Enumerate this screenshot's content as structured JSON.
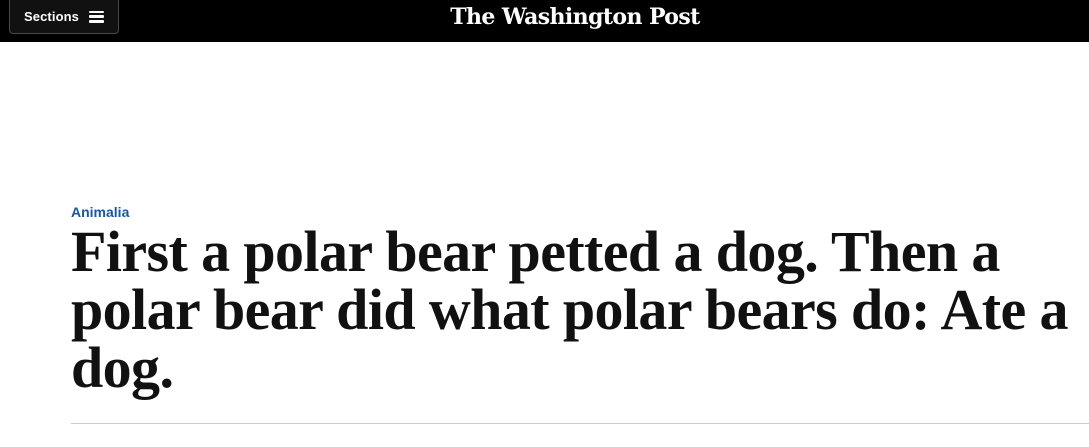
{
  "header": {
    "sections_label": "Sections",
    "brand": "The Washington Post",
    "icons": {
      "menu": "hamburger-icon"
    }
  },
  "article": {
    "kicker": "Animalia",
    "headline": "First a polar bear petted a dog. Then a polar bear did what polar bears do: Ate a dog."
  },
  "colors": {
    "topbar": "#000000",
    "kicker": "#1955a5",
    "headline": "#111111"
  }
}
